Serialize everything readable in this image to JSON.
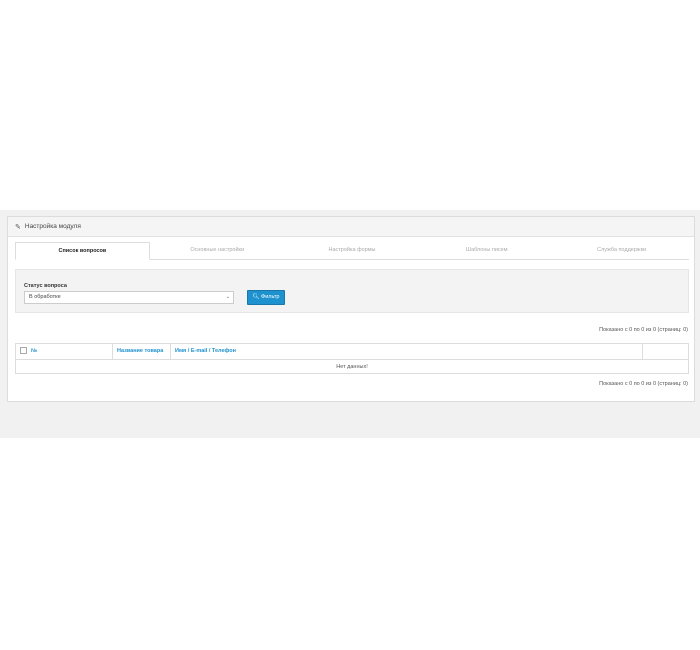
{
  "panel": {
    "title": "Настройка модуля"
  },
  "tabs": [
    {
      "label": "Список вопросов",
      "active": true
    },
    {
      "label": "Основные настройки",
      "active": false
    },
    {
      "label": "Настройка формы",
      "active": false
    },
    {
      "label": "Шаблоны писем",
      "active": false
    },
    {
      "label": "Служба поддержки",
      "active": false
    }
  ],
  "filter": {
    "status_label": "Статус вопроса",
    "status_value": "В обработке",
    "button_label": "Фильтр"
  },
  "pagination": {
    "top_text": "Показано с 0 по 0 из 0 (страниц: 0)",
    "bottom_text": "Показано с 0 по 0 из 0 (страниц: 0)"
  },
  "table": {
    "columns": [
      "№",
      "Название товара",
      "Имя / E-mail / Телефон",
      ""
    ],
    "empty_text": "Нет данных!"
  },
  "icons": {
    "heading": "pencil-icon",
    "filter_button": "search-icon",
    "select": "chevron-down-icon"
  },
  "colors": {
    "accent": "#1e91cf"
  }
}
